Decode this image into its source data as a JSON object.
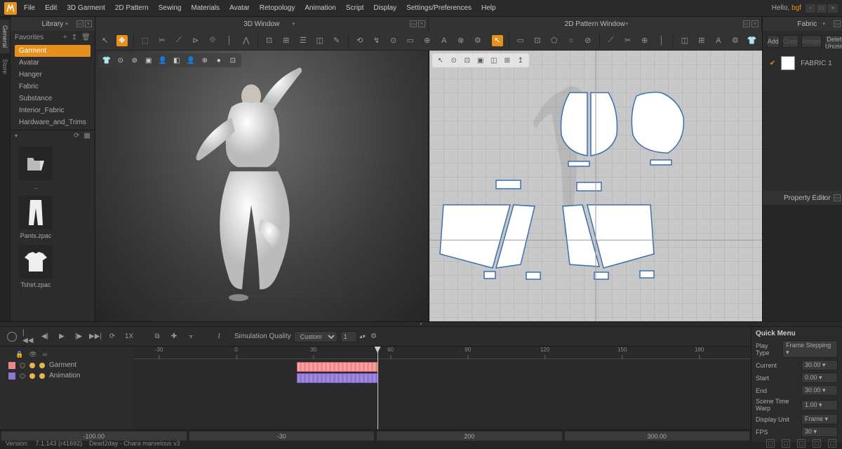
{
  "menu": [
    "File",
    "Edit",
    "3D Garment",
    "2D Pattern",
    "Sewing",
    "Materials",
    "Avatar",
    "Retopology",
    "Animation",
    "Script",
    "Display",
    "Settings/Preferences",
    "Help"
  ],
  "hello_prefix": "Hello, ",
  "hello_user": "bgf",
  "vtabs": [
    "General",
    "Store"
  ],
  "library": {
    "tab": "Library",
    "fav_head": "Favorites",
    "items": [
      "Garment",
      "Avatar",
      "Hanger",
      "Fabric",
      "Substance",
      "Interior_Fabric",
      "Hardware_and_Trims"
    ],
    "assets": [
      {
        "name": "..",
        "icon": "folder"
      },
      {
        "name": "Pants.zpac",
        "icon": "pants"
      },
      {
        "name": "Tshirt.zpac",
        "icon": "tshirt"
      }
    ]
  },
  "view3d_tab": "3D Window",
  "view2d_tab": "2D Pattern Window",
  "fabric": {
    "tab": "Fabric",
    "buttons": [
      "Add",
      "Copy",
      "Assign",
      "Delete Unused"
    ],
    "items": [
      "FABRIC 1"
    ]
  },
  "property_tab": "Property Editor",
  "anim": {
    "sim_label": "Simulation Quality",
    "sim_value": "Custom",
    "one": "1",
    "speed": "1X",
    "tracks": [
      {
        "name": "Garment",
        "color": "#f08888"
      },
      {
        "name": "Animation",
        "color": "#8e75d0"
      }
    ],
    "ticks": [
      -30,
      0,
      30,
      60,
      90,
      120,
      150,
      180
    ],
    "nums": [
      "-100.00",
      "-30",
      "200",
      "300.00"
    ]
  },
  "quick": {
    "title": "Quick Menu",
    "rows": [
      {
        "label": "Play Type",
        "value": "Frame Stepping"
      },
      {
        "label": "Current",
        "value": "30.00"
      },
      {
        "label": "Start",
        "value": "0.00"
      },
      {
        "label": "End",
        "value": "30.00"
      },
      {
        "label": "Scene Time Warp",
        "value": "1.00"
      },
      {
        "label": "Display Unit",
        "value": "Frame"
      },
      {
        "label": "FPS",
        "value": "30"
      }
    ]
  },
  "status": {
    "version_label": "Version:",
    "version": "7.1.143 (r41692)",
    "scene": "Dead2day - Chara marvelous v3"
  }
}
